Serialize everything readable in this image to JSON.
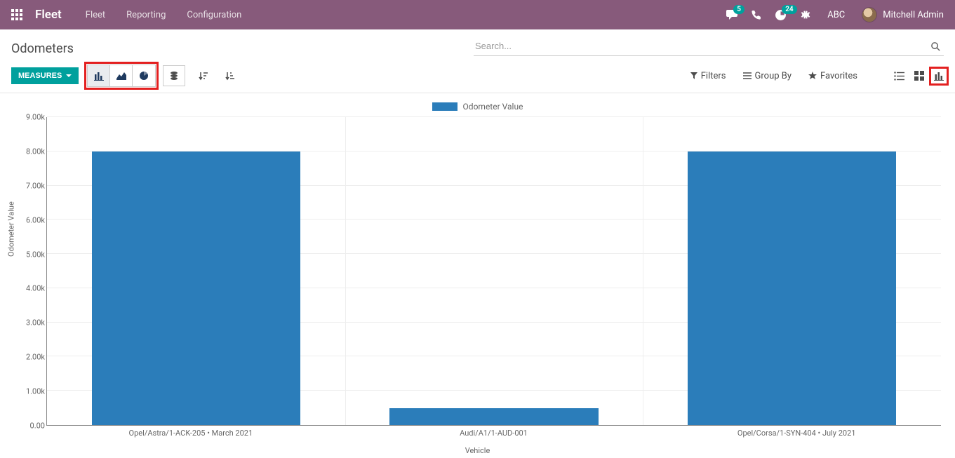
{
  "navbar": {
    "brand": "Fleet",
    "links": [
      "Fleet",
      "Reporting",
      "Configuration"
    ],
    "msg_badge": "5",
    "activity_badge": "24",
    "company": "ABC",
    "user": "Mitchell Admin"
  },
  "control": {
    "title": "Odometers",
    "search_placeholder": "Search...",
    "measures_label": "MEASURES",
    "filters_label": "Filters",
    "groupby_label": "Group By",
    "favorites_label": "Favorites"
  },
  "chart_data": {
    "type": "bar",
    "title": "",
    "legend": "Odometer Value",
    "xlabel": "Vehicle",
    "ylabel": "Odometer Value",
    "ylim": [
      0,
      9000
    ],
    "y_ticks": [
      "0.00",
      "1.00k",
      "2.00k",
      "3.00k",
      "4.00k",
      "5.00k",
      "6.00k",
      "7.00k",
      "8.00k",
      "9.00k"
    ],
    "categories": [
      "Opel/Astra/1-ACK-205 • March 2021",
      "Audi/A1/1-AUD-001",
      "Opel/Corsa/1-SYN-404 • July 2021"
    ],
    "values": [
      8000,
      500,
      8000
    ]
  }
}
